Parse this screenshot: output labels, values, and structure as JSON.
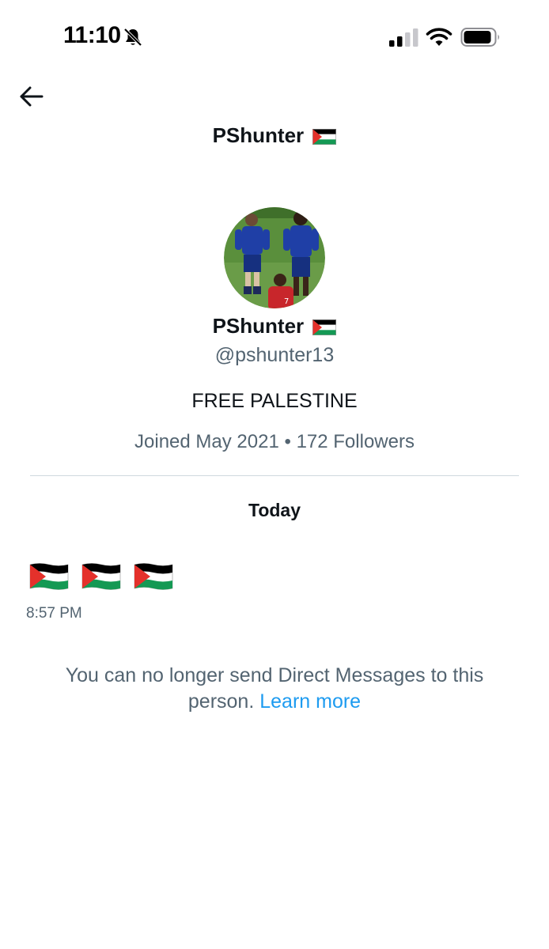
{
  "status_bar": {
    "time": "11:10",
    "icons": [
      "bell-muted-icon",
      "cellular-signal-icon",
      "wifi-icon",
      "battery-icon"
    ]
  },
  "header": {
    "back_icon": "arrow-left-icon",
    "title": "PShunter",
    "flag": "palestine-flag"
  },
  "profile": {
    "name": "PShunter",
    "flag": "palestine-flag",
    "handle": "@pshunter13",
    "bio": "FREE PALESTINE",
    "joined": "Joined May 2021",
    "separator": "•",
    "followers": "172 Followers"
  },
  "conversation": {
    "date_label": "Today",
    "messages": [
      {
        "content": [
          "palestine-flag",
          "palestine-flag",
          "palestine-flag"
        ],
        "time": "8:57 PM"
      }
    ],
    "notice_text": "You can no longer send Direct Messages to this person.",
    "notice_link": "Learn more"
  },
  "colors": {
    "text_primary": "#0f1419",
    "text_secondary": "#536471",
    "link": "#1d9bf0",
    "divider": "#cfd9de",
    "flag_black": "#000000",
    "flag_white": "#ffffff",
    "flag_green": "#149954",
    "flag_red": "#e4312b"
  }
}
